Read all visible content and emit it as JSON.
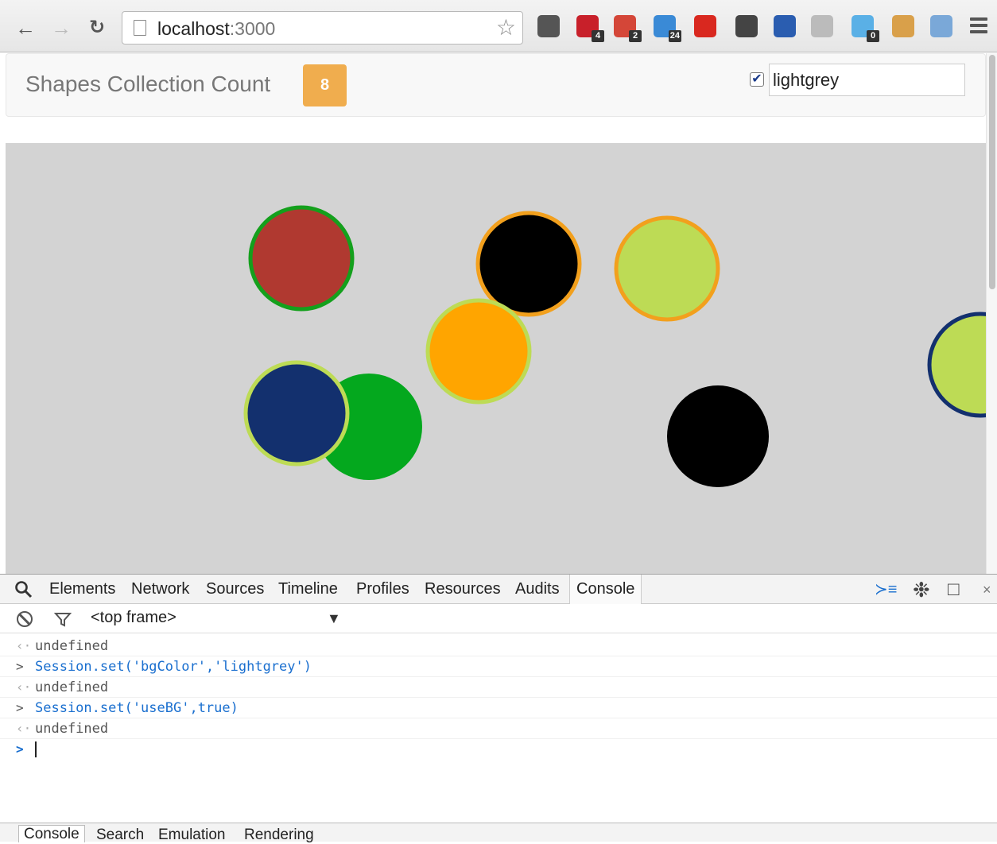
{
  "browser": {
    "url_host": "localhost",
    "url_port": ":3000",
    "extensions": [
      {
        "name": "pocket-icon",
        "color": "#555555",
        "badge": ""
      },
      {
        "name": "lastpass-icon",
        "color": "#c8202a",
        "badge": "4"
      },
      {
        "name": "gmail-icon",
        "color": "#d44638",
        "badge": "2"
      },
      {
        "name": "tasks-icon",
        "color": "#3a8ad6",
        "badge": "24"
      },
      {
        "name": "adblock-icon",
        "color": "#d9281f",
        "badge": ""
      },
      {
        "name": "evernote-icon",
        "color": "#444444",
        "badge": ""
      },
      {
        "name": "y-icon",
        "color": "#2a5db0",
        "badge": ""
      },
      {
        "name": "search-ext-icon",
        "color": "#bbbbbb",
        "badge": ""
      },
      {
        "name": "ghostery-icon",
        "color": "#5ab0e6",
        "badge": "0"
      },
      {
        "name": "plug-icon",
        "color": "#d9a04a",
        "badge": ""
      },
      {
        "name": "window-icon",
        "color": "#7aa8d8",
        "badge": ""
      }
    ]
  },
  "app": {
    "title": "Shapes Collection Count",
    "count": "8",
    "use_bg_checked": true,
    "bg_color_value": "lightgrey",
    "canvas_bg": "#d3d3d3"
  },
  "shapes": [
    {
      "fill": "#b03930",
      "stroke": "#14a01c"
    },
    {
      "fill": "#000000",
      "stroke": "#f2a01d"
    },
    {
      "fill": "#bddb55",
      "stroke": "#f2a01d"
    },
    {
      "fill": "#04a81e",
      "stroke": "none"
    },
    {
      "fill": "#13306e",
      "stroke": "#bddb55"
    },
    {
      "fill": "#ffa500",
      "stroke": "#bddb55"
    },
    {
      "fill": "#000000",
      "stroke": "none"
    },
    {
      "fill": "#bddb55",
      "stroke": "#13306e"
    }
  ],
  "devtools": {
    "tabs": [
      "Elements",
      "Network",
      "Sources",
      "Timeline",
      "Profiles",
      "Resources",
      "Audits",
      "Console"
    ],
    "active_tab": "Console",
    "frame": "<top frame>",
    "log": [
      {
        "type": "result",
        "arrow": "‹·",
        "text": "undefined"
      },
      {
        "type": "input",
        "arrow": ">",
        "text": "Session.set('bgColor','lightgrey')"
      },
      {
        "type": "result",
        "arrow": "‹·",
        "text": "undefined"
      },
      {
        "type": "input",
        "arrow": ">",
        "text": "Session.set('useBG',true)"
      },
      {
        "type": "result",
        "arrow": "‹·",
        "text": "undefined"
      }
    ],
    "prompt_arrow": ">",
    "drawer_tabs": [
      "Console",
      "Search",
      "Emulation",
      "Rendering"
    ]
  }
}
